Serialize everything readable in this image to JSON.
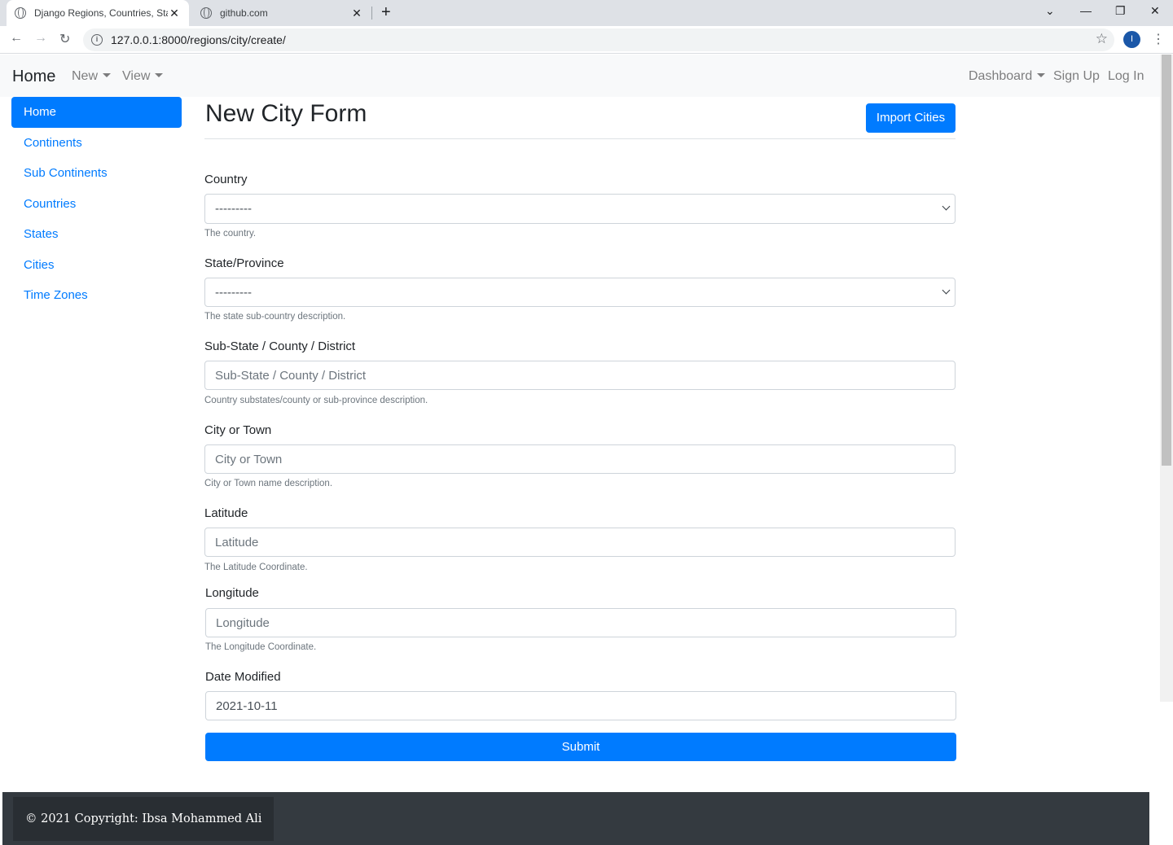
{
  "browser": {
    "tabs": [
      {
        "title": "Django Regions, Countries, State"
      },
      {
        "title": "github.com"
      }
    ],
    "url": "127.0.0.1:8000/regions/city/create/",
    "profile_initial": "I"
  },
  "navbar": {
    "brand": "Home",
    "left_items": [
      "New",
      "View"
    ],
    "right_items": {
      "dashboard": "Dashboard",
      "signup": "Sign Up",
      "login": "Log In"
    }
  },
  "sidebar": {
    "items": [
      {
        "label": "Home",
        "active": true
      },
      {
        "label": "Continents"
      },
      {
        "label": "Sub Continents"
      },
      {
        "label": "Countries"
      },
      {
        "label": "States"
      },
      {
        "label": "Cities"
      },
      {
        "label": "Time Zones"
      }
    ]
  },
  "main": {
    "title": "New City Form",
    "import_button": "Import Cities",
    "fields": {
      "country": {
        "label": "Country",
        "value": "---------",
        "help": "The country."
      },
      "state": {
        "label": "State/Province",
        "value": "---------",
        "help": "The state sub-country description."
      },
      "substate": {
        "label": "Sub-State / County / District",
        "placeholder": "Sub-State / County / District",
        "help": "Country substates/county or sub-province description."
      },
      "city": {
        "label": "City or Town",
        "placeholder": "City or Town",
        "help": "City or Town name description."
      },
      "latitude": {
        "label": "Latitude",
        "placeholder": "Latitude",
        "help": "The Latitude Coordinate."
      },
      "longitude": {
        "label": "Longitude",
        "placeholder": "Longitude",
        "help": "The Longitude Coordinate."
      },
      "date_modified": {
        "label": "Date Modified",
        "value": "2021-10-11"
      }
    },
    "submit": "Submit"
  },
  "footer": {
    "copyright": "© 2021 Copyright: Ibsa Mohammed Ali"
  }
}
